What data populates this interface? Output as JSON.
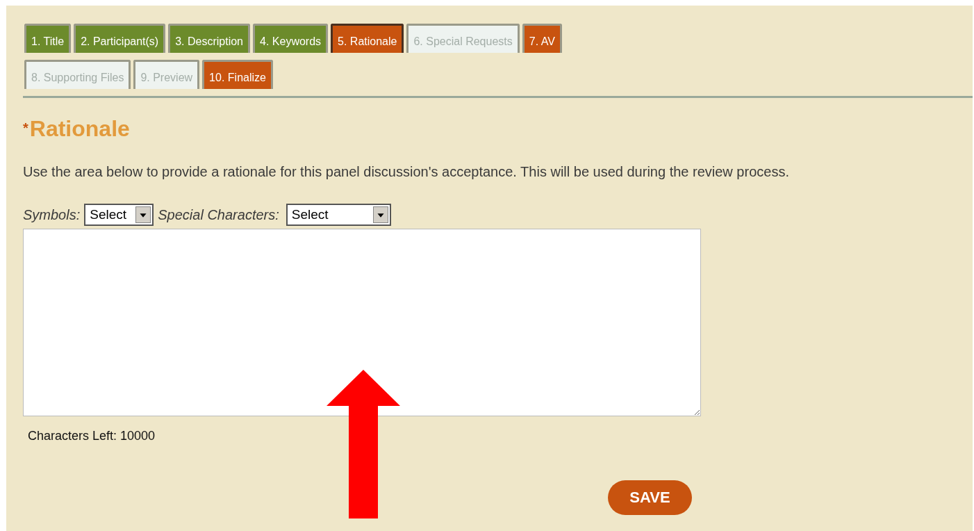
{
  "tabs": [
    {
      "label": "1. Title",
      "kind": "complete",
      "selected": false
    },
    {
      "label": "2. Participant(s)",
      "kind": "complete",
      "selected": false
    },
    {
      "label": "3. Description",
      "kind": "complete",
      "selected": false
    },
    {
      "label": "4. Keywords",
      "kind": "complete",
      "selected": false
    },
    {
      "label": "5. Rationale",
      "kind": "attention",
      "selected": true
    },
    {
      "label": "6. Special Requests",
      "kind": "pending",
      "selected": false
    },
    {
      "label": "7. AV",
      "kind": "attention",
      "selected": false
    },
    {
      "label": "8. Supporting Files",
      "kind": "pending",
      "selected": false
    },
    {
      "label": "9. Preview",
      "kind": "pending",
      "selected": false
    },
    {
      "label": "10. Finalize",
      "kind": "attention",
      "selected": false
    }
  ],
  "heading": {
    "required_mark": "*",
    "title": "Rationale"
  },
  "instructions": "Use the area below to provide a rationale for this panel discussion's acceptance. This will be used during the review process.",
  "symbols": {
    "label": "Symbols:",
    "value": "Select"
  },
  "special_characters": {
    "label": "Special Characters:",
    "value": "Select"
  },
  "characters_left": "Characters Left: 10000",
  "save_button": "SAVE"
}
